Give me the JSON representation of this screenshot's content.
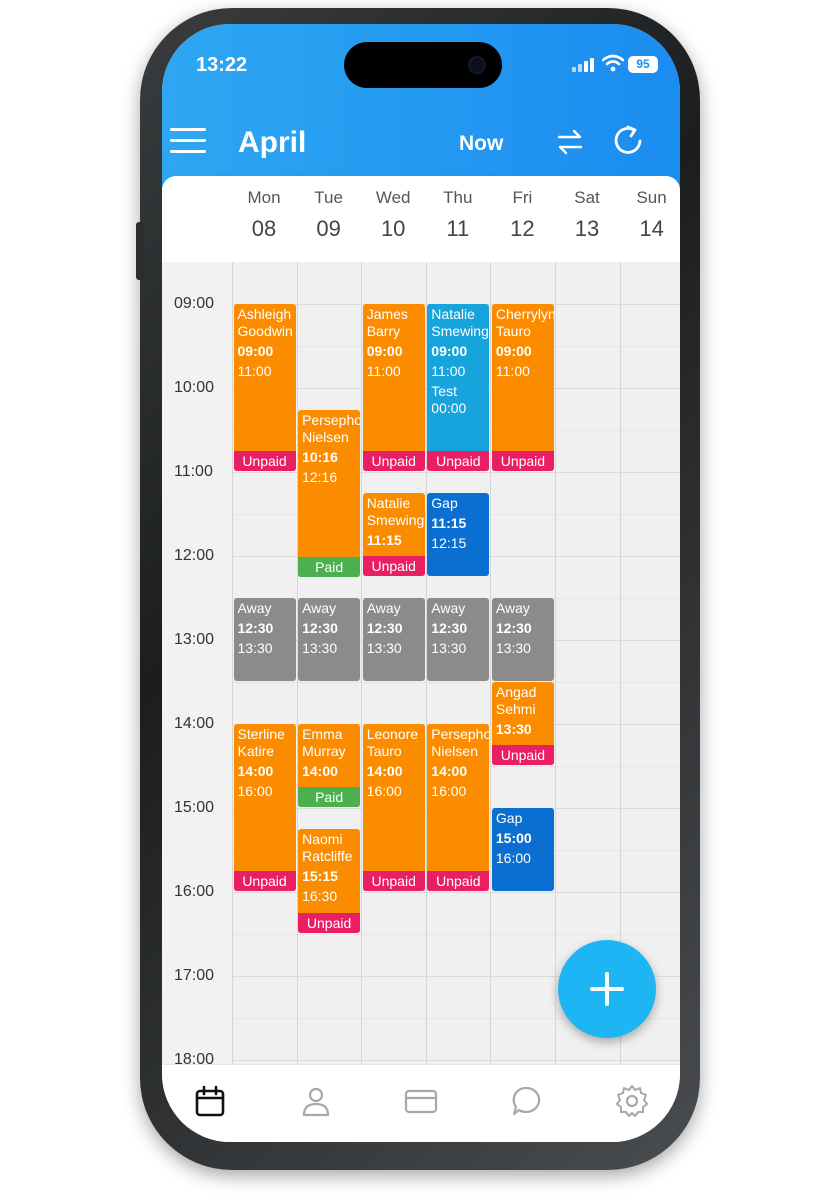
{
  "status_bar": {
    "time": "13:22",
    "battery": "95"
  },
  "header": {
    "month": "April",
    "now_label": "Now"
  },
  "days": [
    {
      "name": "Mon",
      "num": "08"
    },
    {
      "name": "Tue",
      "num": "09"
    },
    {
      "name": "Wed",
      "num": "10"
    },
    {
      "name": "Thu",
      "num": "11"
    },
    {
      "name": "Fri",
      "num": "12"
    },
    {
      "name": "Sat",
      "num": "13"
    },
    {
      "name": "Sun",
      "num": "14"
    }
  ],
  "times": [
    "09:00",
    "10:00",
    "11:00",
    "12:00",
    "13:00",
    "14:00",
    "15:00",
    "16:00",
    "17:00",
    "18:00"
  ],
  "colors": {
    "booking": "#fb8c00",
    "booking_blue": "#17a4dd",
    "gap": "#0b6fd1",
    "away": "#8b8b8b",
    "unpaid": "#e91e63",
    "paid": "#4caf50",
    "header": "#1b8cf0",
    "fab": "#1eb5f5"
  },
  "events": [
    {
      "day": 0,
      "start": "09:00",
      "end": "11:00",
      "title": "Ashleigh Goodwin",
      "t1": "09:00",
      "t2": "11:00",
      "kind": "booking",
      "status": "Unpaid"
    },
    {
      "day": 1,
      "start": "10:16",
      "end": "12:16",
      "title": "Persephone Nielsen",
      "t1": "10:16",
      "t2": "12:16",
      "kind": "booking",
      "status": "Paid"
    },
    {
      "day": 2,
      "start": "09:00",
      "end": "11:00",
      "title": "James Barry",
      "t1": "09:00",
      "t2": "11:00",
      "kind": "booking",
      "status": "Unpaid"
    },
    {
      "day": 3,
      "start": "09:00",
      "end": "11:00",
      "title": "Natalie Smewing",
      "t1": "09:00",
      "t2": "11:00",
      "note": "Test 00:00",
      "kind": "booking_blue",
      "status": "Unpaid"
    },
    {
      "day": 4,
      "start": "09:00",
      "end": "11:00",
      "title": "Cherrylyn Tauro",
      "t1": "09:00",
      "t2": "11:00",
      "kind": "booking",
      "status": "Unpaid"
    },
    {
      "day": 2,
      "start": "11:15",
      "end": "12:15",
      "title": "Natalie Smewing",
      "t1": "11:15",
      "t2": "",
      "kind": "booking",
      "status": "Unpaid"
    },
    {
      "day": 3,
      "start": "11:15",
      "end": "12:15",
      "title": "Gap",
      "t1": "11:15",
      "t2": "12:15",
      "kind": "gap",
      "status": ""
    },
    {
      "day": 0,
      "start": "12:30",
      "end": "13:30",
      "title": "Away",
      "t1": "12:30",
      "t2": "13:30",
      "kind": "away",
      "status": ""
    },
    {
      "day": 1,
      "start": "12:30",
      "end": "13:30",
      "title": "Away",
      "t1": "12:30",
      "t2": "13:30",
      "kind": "away",
      "status": ""
    },
    {
      "day": 2,
      "start": "12:30",
      "end": "13:30",
      "title": "Away",
      "t1": "12:30",
      "t2": "13:30",
      "kind": "away",
      "status": ""
    },
    {
      "day": 3,
      "start": "12:30",
      "end": "13:30",
      "title": "Away",
      "t1": "12:30",
      "t2": "13:30",
      "kind": "away",
      "status": ""
    },
    {
      "day": 4,
      "start": "12:30",
      "end": "13:30",
      "title": "Away",
      "t1": "12:30",
      "t2": "13:30",
      "kind": "away",
      "status": ""
    },
    {
      "day": 4,
      "start": "13:30",
      "end": "14:30",
      "title": "Angad Sehmi",
      "t1": "13:30",
      "t2": "",
      "kind": "booking",
      "status": "Unpaid"
    },
    {
      "day": 0,
      "start": "14:00",
      "end": "16:00",
      "title": "Sterline Katire",
      "t1": "14:00",
      "t2": "16:00",
      "kind": "booking",
      "status": "Unpaid"
    },
    {
      "day": 1,
      "start": "14:00",
      "end": "15:00",
      "title": "Emma Murray",
      "t1": "14:00",
      "t2": "",
      "kind": "booking",
      "status": "Paid"
    },
    {
      "day": 2,
      "start": "14:00",
      "end": "16:00",
      "title": "Leonore Tauro",
      "t1": "14:00",
      "t2": "16:00",
      "kind": "booking",
      "status": "Unpaid"
    },
    {
      "day": 3,
      "start": "14:00",
      "end": "16:00",
      "title": "Persephone Nielsen",
      "t1": "14:00",
      "t2": "16:00",
      "kind": "booking",
      "status": "Unpaid"
    },
    {
      "day": 4,
      "start": "15:00",
      "end": "16:00",
      "title": "Gap",
      "t1": "15:00",
      "t2": "16:00",
      "kind": "gap",
      "status": ""
    },
    {
      "day": 1,
      "start": "15:15",
      "end": "16:30",
      "title": "Naomi Ratcliffe",
      "t1": "15:15",
      "t2": "16:30",
      "kind": "booking",
      "status": "Unpaid"
    }
  ],
  "tabs": [
    {
      "icon": "calendar-icon",
      "active": true
    },
    {
      "icon": "person-icon",
      "active": false
    },
    {
      "icon": "card-icon",
      "active": false
    },
    {
      "icon": "chat-icon",
      "active": false
    },
    {
      "icon": "gear-icon",
      "active": false
    }
  ]
}
